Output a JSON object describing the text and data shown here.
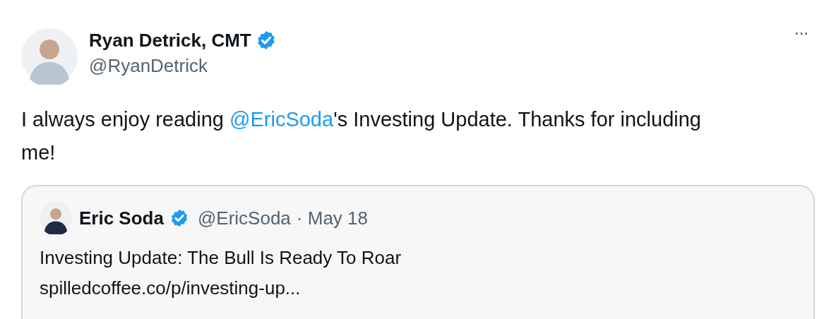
{
  "author": {
    "name": "Ryan Detrick, CMT",
    "verified": true,
    "handle": "@RyanDetrick"
  },
  "more_menu": "···",
  "tweet_text": [
    {
      "kind": "text",
      "text": "I always enjoy reading "
    },
    {
      "kind": "mention",
      "text": "@EricSoda"
    },
    {
      "kind": "text",
      "text": "'s Investing Update. Thanks for including me!"
    }
  ],
  "quoted_tweet": {
    "name": "Eric Soda",
    "verified": true,
    "handle": "@EricSoda",
    "date": "· May 18",
    "lines": [
      "Investing Update: The Bull Is Ready To Roar",
      "spilledcoffee.co/p/investing-up..."
    ]
  }
}
